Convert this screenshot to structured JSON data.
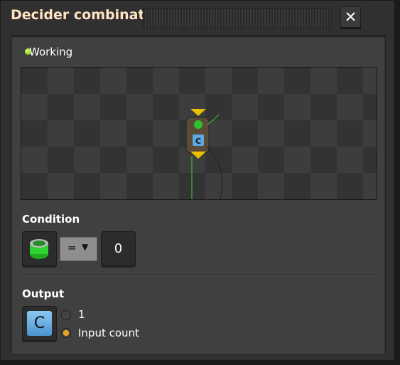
{
  "window": {
    "title": "Decider combinator",
    "close_icon": "close-icon"
  },
  "status": {
    "text": "Working",
    "color": "#88d400"
  },
  "condition": {
    "label": "Condition",
    "first_signal": "green-signal-icon",
    "comparator": "=",
    "constant": "0"
  },
  "output": {
    "label": "Output",
    "signal": "C",
    "options": [
      {
        "label": "1",
        "selected": false
      },
      {
        "label": "Input count",
        "selected": true
      }
    ],
    "selected_color": "#e8a020"
  }
}
